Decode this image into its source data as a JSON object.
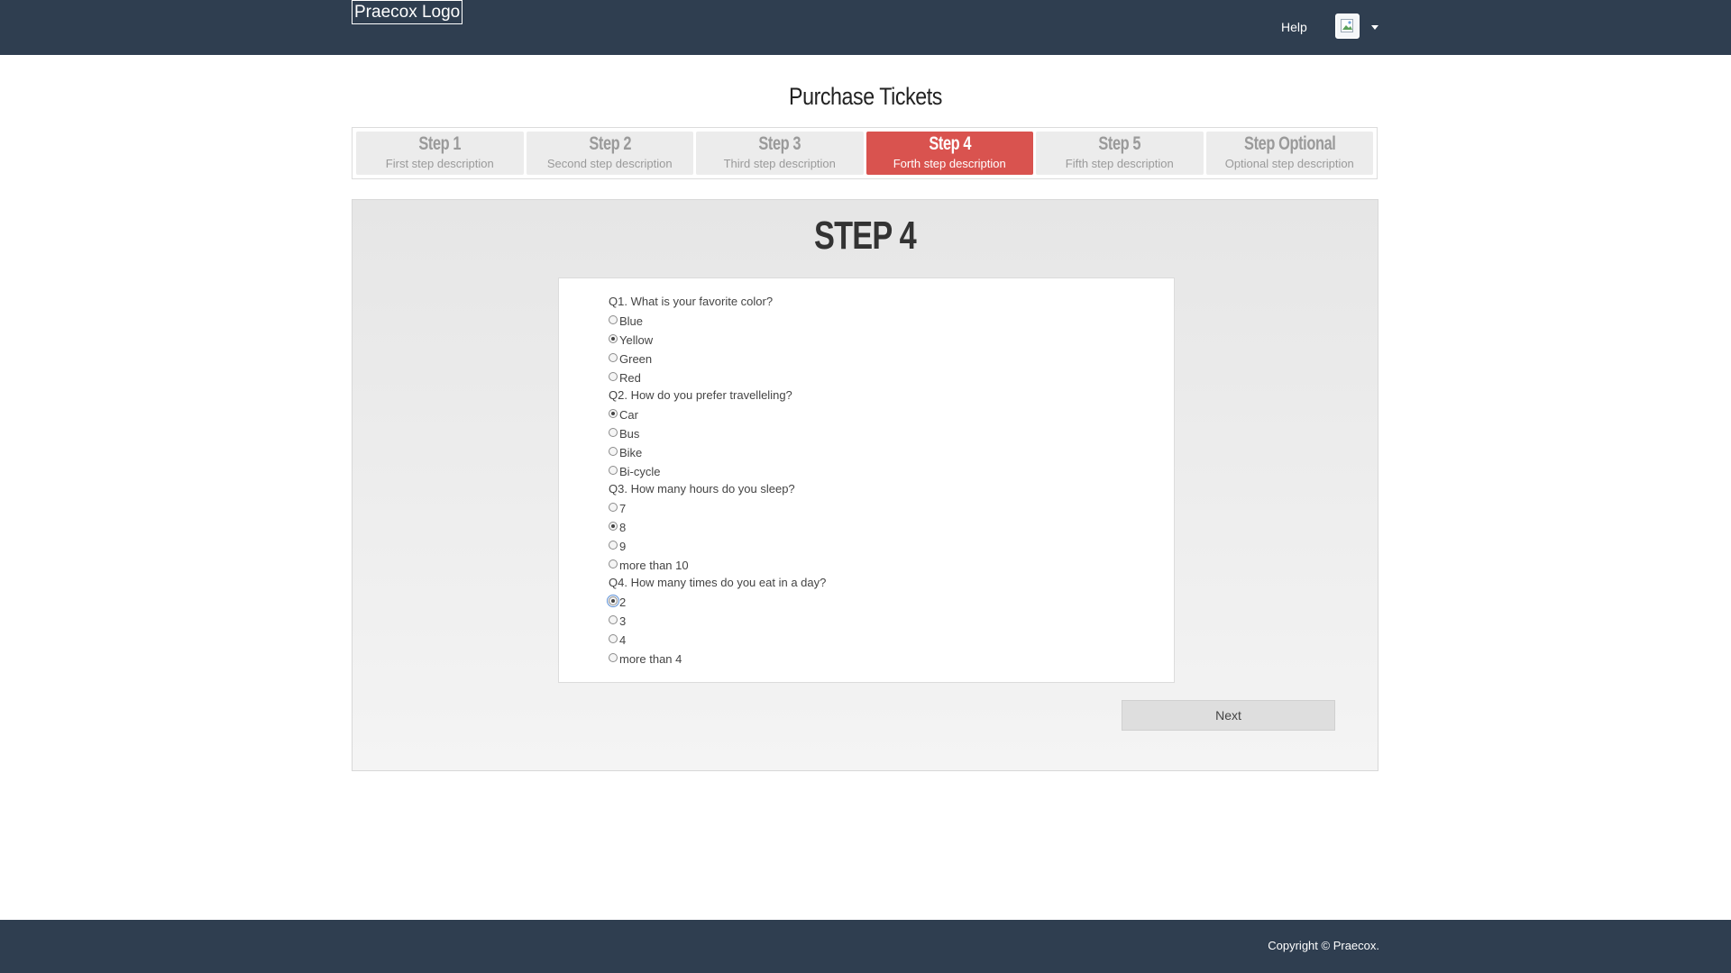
{
  "header": {
    "logo_text": "Praecox Logo",
    "help_label": "Help",
    "avatar_icon": "broken-image-icon",
    "menu_icon": "caret-down-icon"
  },
  "page_title": "Purchase Tickets",
  "steps": [
    {
      "title": "Step 1",
      "desc": "First step description",
      "active": false
    },
    {
      "title": "Step 2",
      "desc": "Second step description",
      "active": false
    },
    {
      "title": "Step 3",
      "desc": "Third step description",
      "active": false
    },
    {
      "title": "Step 4",
      "desc": "Forth step description",
      "active": true
    },
    {
      "title": "Step 5",
      "desc": "Fifth step description",
      "active": false
    },
    {
      "title": "Step Optional",
      "desc": "Optional step description",
      "active": false
    }
  ],
  "panel": {
    "heading": "STEP 4",
    "questions": [
      {
        "label": "Q1. What is your favorite color?",
        "options": [
          "Blue",
          "Yellow",
          "Green",
          "Red"
        ],
        "selected": 1
      },
      {
        "label": "Q2. How do you prefer travelleling?",
        "options": [
          "Car",
          "Bus",
          "Bike",
          "Bi-cycle"
        ],
        "selected": 0
      },
      {
        "label": "Q3. How many hours do you sleep?",
        "options": [
          "7",
          "8",
          "9",
          "more than 10"
        ],
        "selected": 1
      },
      {
        "label": "Q4. How many times do you eat in a day?",
        "options": [
          "2",
          "3",
          "4",
          "more than 4"
        ],
        "selected": 0
      }
    ],
    "next_label": "Next"
  },
  "footer": {
    "copyright": "Copyright © Praecox."
  },
  "colors": {
    "topbar": "#2f3e50",
    "active_step": "#d9534f"
  }
}
